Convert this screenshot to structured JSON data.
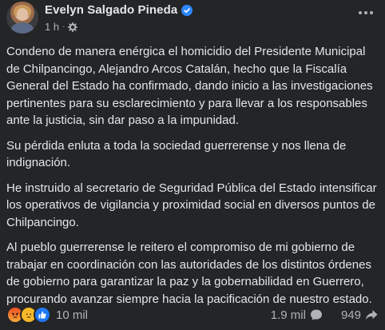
{
  "post": {
    "author": "Evelyn Salgado Pineda",
    "time": "1 h",
    "paragraphs": [
      "Condeno de manera enérgica el homicidio del Presidente Municipal de Chilpancingo, Alejandro Arcos Catalán, hecho que la Fiscalía General del Estado ha confirmado, dando inicio a las investigaciones pertinentes para su esclarecimiento y para llevar a los responsables ante la justicia, sin dar paso a la impunidad.",
      "Su pérdida enluta a toda la sociedad guerrerense y nos llena de indignación.",
      "He instruido al secretario de Seguridad Pública del Estado intensificar los operativos de vigilancia y proximidad social en diversos puntos de Chilpancingo.",
      "Al pueblo guerrerense le reitero el compromiso de mi gobierno de trabajar en coordinación con las autoridades de los distintos órdenes de gobierno para garantizar la paz y la gobernabilidad en Guerrero, procurando avanzar siempre hacia la pacificación de nuestro estado."
    ],
    "reactions": {
      "icons": [
        "angry-icon",
        "sad-icon",
        "like-icon"
      ],
      "count": "10 mil"
    },
    "comments_count": "1.9 mil",
    "shares_count": "949"
  },
  "colors": {
    "background": "#242526",
    "text": "#e4e6eb",
    "secondary_text": "#b0b3b8",
    "verified": "#2d88ff"
  }
}
